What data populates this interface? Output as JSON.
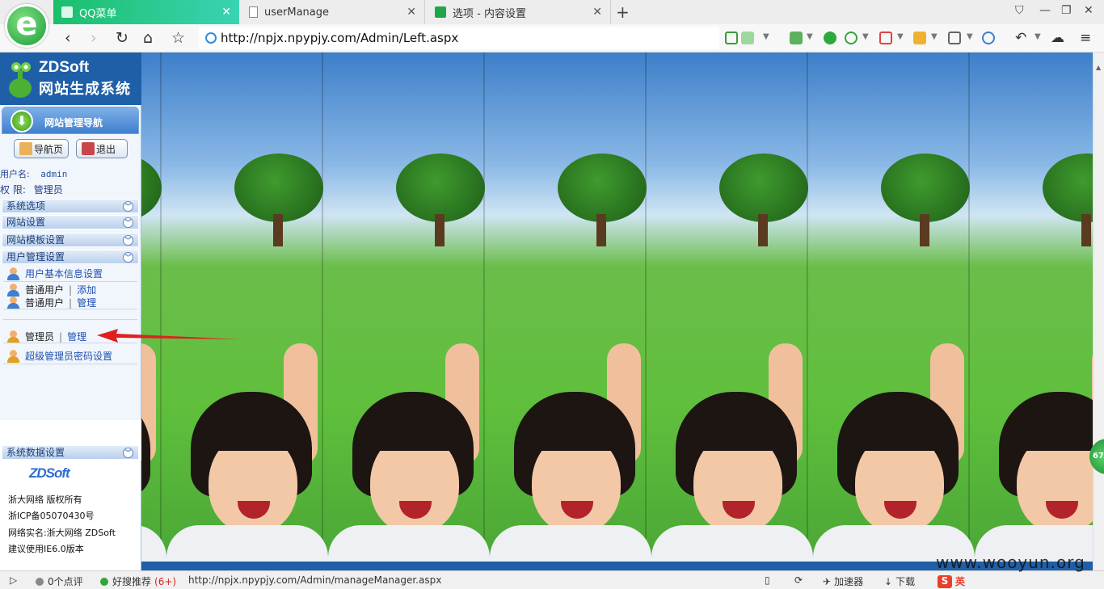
{
  "browser": {
    "tabs": [
      {
        "label": "QQ菜单",
        "active": true
      },
      {
        "label": "userManage",
        "active": false
      },
      {
        "label": "选项 - 内容设置",
        "active": false
      }
    ],
    "address": "http://npjx.npypjy.com/Admin/Left.aspx",
    "nav_icons": [
      "back-arrow-icon",
      "forward-arrow-icon",
      "reload-icon",
      "home-icon",
      "star-icon"
    ]
  },
  "left": {
    "brand_line1": "ZDSoft",
    "brand_line2": "网站生成系统",
    "nav_title": "网站管理导航",
    "btn_home": "导航页",
    "btn_logout": "退出",
    "username_label": "用户名:",
    "username_value": "admin",
    "role_label": "权 限:",
    "role_value": "管理员",
    "sections": [
      "系统选项",
      "网站设置",
      "网站模板设置",
      "用户管理设置"
    ],
    "items": {
      "basic_info": "用户基本信息设置",
      "normal_user": "普通用户",
      "add": "添加",
      "manage": "管理",
      "admin": "管理员",
      "super_pw": "超级管理员密码设置"
    },
    "sysdata": "系统数据设置"
  },
  "footer": {
    "brand": "ZDSoft",
    "lines": [
      "浙大网络 版权所有",
      "浙ICP备05070430号",
      "网络实名:浙大网络 ZDSoft",
      "建议使用IE6.0版本"
    ]
  },
  "float_ball": "67",
  "status": {
    "comments": "0个点评",
    "recommend": "好搜推荐",
    "recommend_count": "(6+)",
    "url": "http://npjx.npypjy.com/Admin/manageManager.aspx",
    "accelerator": "加速器",
    "download": "下载",
    "ime": "英"
  },
  "watermark": "www.wooyun.org",
  "colors": {
    "accent": "#1f5fa8",
    "tab_active": "#1bbf6a",
    "link": "#1f4fb0"
  }
}
